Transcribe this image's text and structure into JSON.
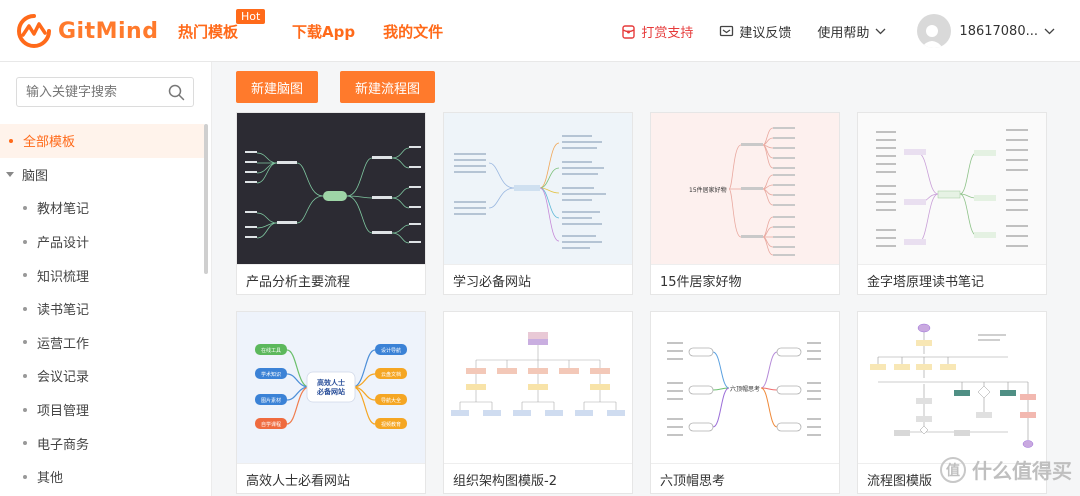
{
  "brand": {
    "name": "GitMind",
    "accent": "#ff6a1a"
  },
  "nav": {
    "hot_templates": "热门模板",
    "hot_badge": "Hot",
    "download_app": "下载App",
    "my_files": "我的文件"
  },
  "right_nav": {
    "reward": "打赏支持",
    "feedback": "建议反馈",
    "help": "使用帮助",
    "user": "18617080..."
  },
  "search": {
    "placeholder": "输入关键字搜索"
  },
  "categories": [
    {
      "label": "全部模板",
      "active": true
    },
    {
      "label": "脑图"
    },
    {
      "label": "教材笔记"
    },
    {
      "label": "产品设计"
    },
    {
      "label": "知识梳理"
    },
    {
      "label": "读书笔记"
    },
    {
      "label": "运营工作"
    },
    {
      "label": "会议记录"
    },
    {
      "label": "项目管理"
    },
    {
      "label": "电子商务"
    },
    {
      "label": "其他"
    }
  ],
  "actions": {
    "new_mindmap": "新建脑图",
    "new_flowchart": "新建流程图"
  },
  "templates": [
    {
      "title": "产品分析主要流程"
    },
    {
      "title": "学习必备网站"
    },
    {
      "title": "15件居家好物",
      "center": "15件居家好物"
    },
    {
      "title": "金字塔原理读书笔记"
    },
    {
      "title": "高效人士必看网站",
      "center": "高效人士\n必备网站",
      "nodes": [
        "在线工具",
        "学术知识",
        "图片素材",
        "自学课程",
        "设计导航",
        "云盘文档",
        "导航大全",
        "视频教育"
      ]
    },
    {
      "title": "组织架构图模版-2"
    },
    {
      "title": "六顶帽思考",
      "center": "六顶帽思考"
    },
    {
      "title": "流程图模版"
    }
  ],
  "watermark": {
    "text": "什么值得买",
    "glyph": "值"
  }
}
